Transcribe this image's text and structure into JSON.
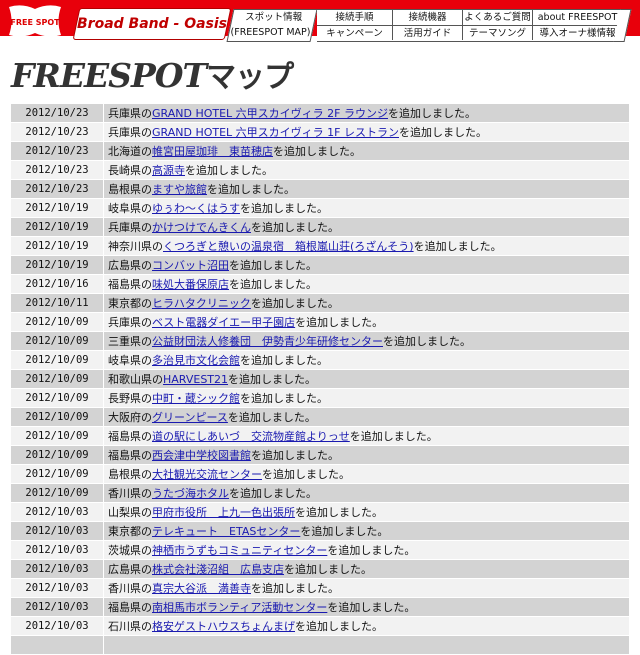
{
  "header": {
    "logo_text": "FREE SPOT",
    "brand": "Broad Band - Oasis",
    "nav_first": {
      "line1": "スポット情報",
      "line2": "(FREESPOT MAP)"
    },
    "nav_row1": [
      "接続手順",
      "接続機器",
      "よくあるご質問",
      "about FREESPOT"
    ],
    "nav_row2": [
      "キャンペーン",
      "活用ガイド",
      "テーマソング",
      "導入オーナ様情報"
    ]
  },
  "page": {
    "title_latin": "FREESPOT",
    "title_kana": "マップ",
    "suffix": "を追加しました。"
  },
  "entries": [
    {
      "date": "2012/10/23",
      "pref": "兵庫県の",
      "name": "GRAND HOTEL 六甲スカイヴィラ 2F ラウンジ"
    },
    {
      "date": "2012/10/23",
      "pref": "兵庫県の",
      "name": "GRAND HOTEL 六甲スカイヴィラ 1F レストラン"
    },
    {
      "date": "2012/10/23",
      "pref": "北海道の",
      "name": "帷宮田屋珈琲　東苗穂店"
    },
    {
      "date": "2012/10/23",
      "pref": "長崎県の",
      "name": "高源寺"
    },
    {
      "date": "2012/10/23",
      "pref": "島根県の",
      "name": "ますや旅館"
    },
    {
      "date": "2012/10/19",
      "pref": "岐阜県の",
      "name": "ゆぅわ～くはうす"
    },
    {
      "date": "2012/10/19",
      "pref": "兵庫県の",
      "name": "かけつけでんきくん"
    },
    {
      "date": "2012/10/19",
      "pref": "神奈川県の",
      "name": "くつろぎと憩いの温泉宿　箱根嵐山荘(ろざんそう)"
    },
    {
      "date": "2012/10/19",
      "pref": "広島県の",
      "name": "コンバット沼田"
    },
    {
      "date": "2012/10/16",
      "pref": "福島県の",
      "name": "味処大番保原店"
    },
    {
      "date": "2012/10/11",
      "pref": "東京都の",
      "name": "ヒラハタクリニック"
    },
    {
      "date": "2012/10/09",
      "pref": "兵庫県の",
      "name": "ベスト電器ダイエー甲子園店"
    },
    {
      "date": "2012/10/09",
      "pref": "三重県の",
      "name": "公益財団法人修養団　伊勢青少年研修センター"
    },
    {
      "date": "2012/10/09",
      "pref": "岐阜県の",
      "name": "多治見市文化会館"
    },
    {
      "date": "2012/10/09",
      "pref": "和歌山県の",
      "name": "HARVEST21"
    },
    {
      "date": "2012/10/09",
      "pref": "長野県の",
      "name": "中町・蔵シック館"
    },
    {
      "date": "2012/10/09",
      "pref": "大阪府の",
      "name": "グリーンピース"
    },
    {
      "date": "2012/10/09",
      "pref": "福島県の",
      "name": "道の駅にしあいづ　交流物産館よりっせ"
    },
    {
      "date": "2012/10/09",
      "pref": "福島県の",
      "name": "西会津中学校図書館"
    },
    {
      "date": "2012/10/09",
      "pref": "島根県の",
      "name": "大社観光交流センター"
    },
    {
      "date": "2012/10/09",
      "pref": "香川県の",
      "name": "うたづ海ホタル"
    },
    {
      "date": "2012/10/03",
      "pref": "山梨県の",
      "name": "甲府市役所　上九一色出張所"
    },
    {
      "date": "2012/10/03",
      "pref": "東京都の",
      "name": "テレキュート　ETASセンター"
    },
    {
      "date": "2012/10/03",
      "pref": "茨城県の",
      "name": "神栖市うずもコミュニティセンター"
    },
    {
      "date": "2012/10/03",
      "pref": "広島県の",
      "name": "株式会社淺沼組　広島支店"
    },
    {
      "date": "2012/10/03",
      "pref": "香川県の",
      "name": "真宗大谷派　満善寺"
    },
    {
      "date": "2012/10/03",
      "pref": "福島県の",
      "name": "南相馬市ボランティア活動センター"
    },
    {
      "date": "2012/10/03",
      "pref": "石川県の",
      "name": "格安ゲストハウスちょんまげ"
    },
    {
      "date": "",
      "pref": "",
      "name": ""
    }
  ]
}
